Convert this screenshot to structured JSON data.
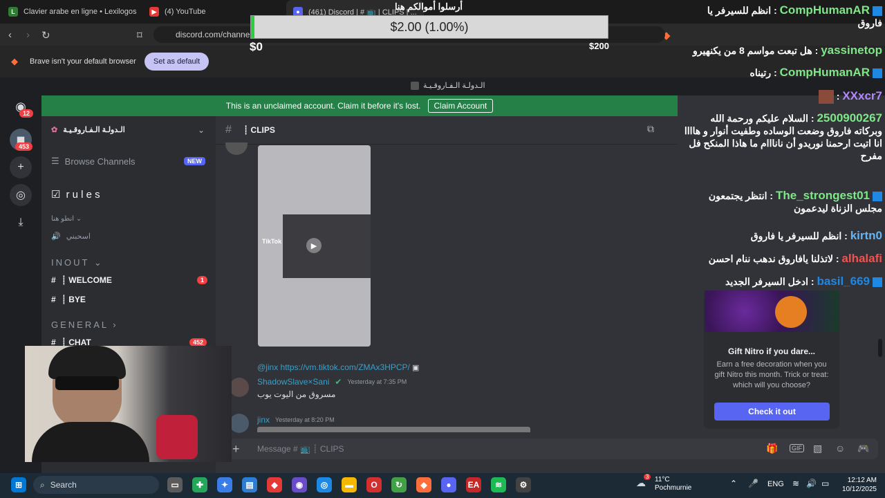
{
  "browser": {
    "tabs": [
      {
        "label": "Clavier arabe en ligne • Lexilogos",
        "icon": "lexilogos-icon"
      },
      {
        "label": "(4) YouTube",
        "icon": "youtube-icon"
      },
      {
        "label": "(461) Discord | # 📺 | CLIPS | ...",
        "icon": "discord-icon"
      }
    ],
    "url": "discord.com/channe",
    "default_banner": "Brave isn't your default browser",
    "set_default": "Set as default"
  },
  "stream_overlay": {
    "donation_title": "أرسلوا أموالكم هنا",
    "progress_label": "$2.00 (1.00%)",
    "progress_fraction": 0.01,
    "min_label": "$0",
    "max_label": "$200"
  },
  "discord": {
    "window_title": "الـدولـة الـفـاروقـيـة",
    "claim_text": "This is an unclaimed account. Claim it before it's lost.",
    "claim_button": "Claim Account",
    "rail_badges": {
      "top": "12",
      "server": "453"
    },
    "server_name": "الـدولـة الـفـاروقـيـة",
    "browse_channels": "Browse Channels",
    "new_badge": "NEW",
    "channels": [
      {
        "label": "r u l e s"
      },
      {
        "label": "انطو هنا ⌄"
      },
      {
        "label": "اسحبني"
      }
    ],
    "categories": {
      "inout": "INOUT ⌄",
      "general": "GENERAL ›"
    },
    "inout_channels": [
      {
        "label": "┊ WELCOME",
        "badge": "1"
      },
      {
        "label": "┊ BYE",
        "badge": ""
      }
    ],
    "chat_channel": {
      "label": "┊ CHAT",
      "badge": "452"
    },
    "channel_header": "┊ CLIPS",
    "video_watermark": "TikTok",
    "messages": [
      {
        "reply": "@jinx https://vm.tiktok.com/ZMAx3HPCP/",
        "author": "ShadowSlave×Sani",
        "time": "Yesterday at 7:35 PM",
        "text": "مسروق من اليوت يوب"
      },
      {
        "author": "jinx",
        "time": "Yesterday at 8:20 PM"
      }
    ],
    "composer_placeholder": "Message # 📺 ┊ CLIPS",
    "nitro": {
      "title": "Gift Nitro if you dare...",
      "body": "Earn a free decoration when you gift Nitro this month. Trick or treat: which will you choose?",
      "button": "Check it out"
    }
  },
  "live_chat": [
    {
      "user": "CompHumanAR",
      "text": "انظم للسيرفر يا فاروق",
      "color": "#7ee787"
    },
    {
      "user": "yassinetop",
      "text": "هل تبعت مواسم 8 من يكنهيرو",
      "color": "#7ee787"
    },
    {
      "user": "CompHumanAR",
      "text": "رتيناه",
      "color": "#7ee787"
    },
    {
      "user": "XXxcr7",
      "text": "",
      "color": "#b388ff"
    },
    {
      "user": "2500900267",
      "text": "السلام عليكم ورحمة الله وبركاته فاروق وضعت الوساده وطفيت أنوار و هاااا انا اتيت ارحمنا نوريدو أن نانااام ما هاذا المنكح فل مفرح",
      "color": "#7ee787"
    },
    {
      "user": "The_strongest01",
      "text": "انتظر يجتمعون مجلس الزناة ليدعمون",
      "color": "#7ee787"
    },
    {
      "user": "kirtn0",
      "text": "انظم للسيرفر يا فاروق",
      "color": "#64b5f6"
    },
    {
      "user": "alhalafi",
      "text": "لاتذلنا يافاروق ندهب ننام احسن",
      "color": "#ef5350"
    },
    {
      "user": "basil_669",
      "text": "ادخل السيرفر الجديد",
      "color": "#1e88e5"
    }
  ],
  "taskbar": {
    "search": "Search",
    "weather_temp": "11°C",
    "weather_place": "Pochmurnie",
    "weather_badge": "3",
    "lang": "ENG",
    "time": "12:12 AM",
    "date": "10/12/2025"
  }
}
